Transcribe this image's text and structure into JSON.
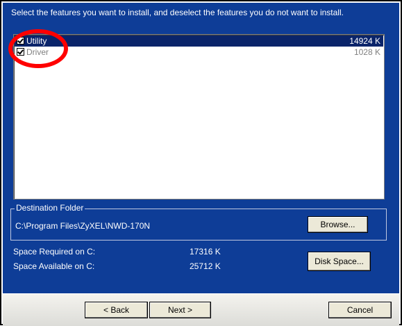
{
  "instruction": "Select the features you want to install, and deselect the features you do not want to install.",
  "features": [
    {
      "name": "Utility",
      "size": "14924 K",
      "checked": true,
      "selected": true
    },
    {
      "name": "Driver",
      "size": "1028 K",
      "checked": true,
      "selected": false
    }
  ],
  "destination": {
    "legend": "Destination Folder",
    "path": "C:\\Program Files\\ZyXEL\\NWD-170N",
    "browse_label": "Browse..."
  },
  "space": {
    "required_label": "Space Required on C:",
    "required_value": "17316 K",
    "available_label": "Space Available on C:",
    "available_value": "25712 K",
    "disk_space_label": "Disk Space..."
  },
  "buttons": {
    "back_label": "< Back",
    "next_label": "Next >",
    "cancel_label": "Cancel"
  },
  "colors": {
    "panel": "#0e3d97",
    "highlight_circle": "#ff0000",
    "selection": "#0a246a"
  },
  "icons": [
    "checkbox-icon"
  ]
}
